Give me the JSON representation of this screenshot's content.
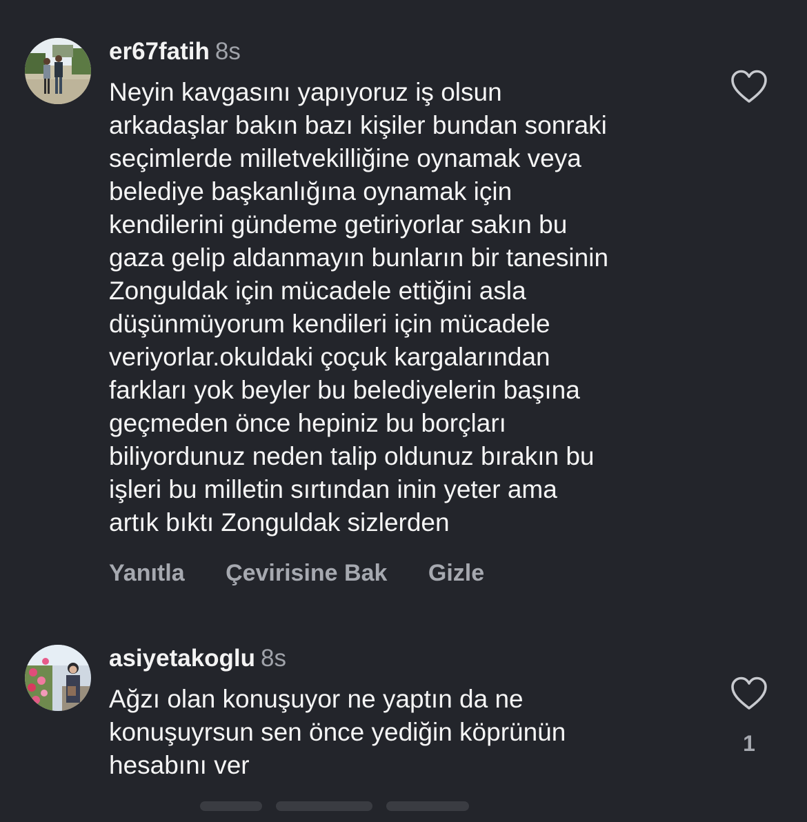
{
  "comments": [
    {
      "username": "er67fatih",
      "time": "8s",
      "avatar_icon": "user-avatar-photo",
      "lines": [
        "Neyin kavgasını yapıyoruz iş olsun",
        "arkadaşlar bakın bazı kişiler bundan sonraki",
        "seçimlerde milletvekilliğine oynamak veya",
        "belediye başkanlığına oynamak için",
        "kendilerini gündeme getiriyorlar sakın bu",
        "gaza gelip aldanmayın bunların bir tanesinin",
        "Zonguldak için mücadele ettiğini asla",
        "düşünmüyorum kendileri için mücadele",
        "veriyorlar.okuldaki çoçuk kargalarından",
        "farkları yok beyler bu belediyelerin başına",
        "geçmeden önce hepiniz bu borçları",
        "biliyordunuz neden talip oldunuz bırakın bu",
        "işleri bu milletin sırtından inin yeter ama",
        "artık bıktı Zonguldak sizlerden"
      ],
      "actions": {
        "reply": "Yanıtla",
        "translate": "Çevirisine Bak",
        "hide": "Gizle"
      },
      "like_icon": "heart-outline-icon"
    },
    {
      "username": "asiyetakoglu",
      "time": "8s",
      "avatar_icon": "user-avatar-photo",
      "lines": [
        "Ağzı olan konuşuyor ne yaptın da ne",
        "konuşuyrsun sen önce yediğin köprünün",
        "hesabını ver"
      ],
      "like_icon": "heart-outline-icon",
      "like_count": "1"
    }
  ],
  "colors": {
    "background": "#23252b",
    "primary_text": "#f5f5f5",
    "secondary_text": "#a6a9b0"
  }
}
